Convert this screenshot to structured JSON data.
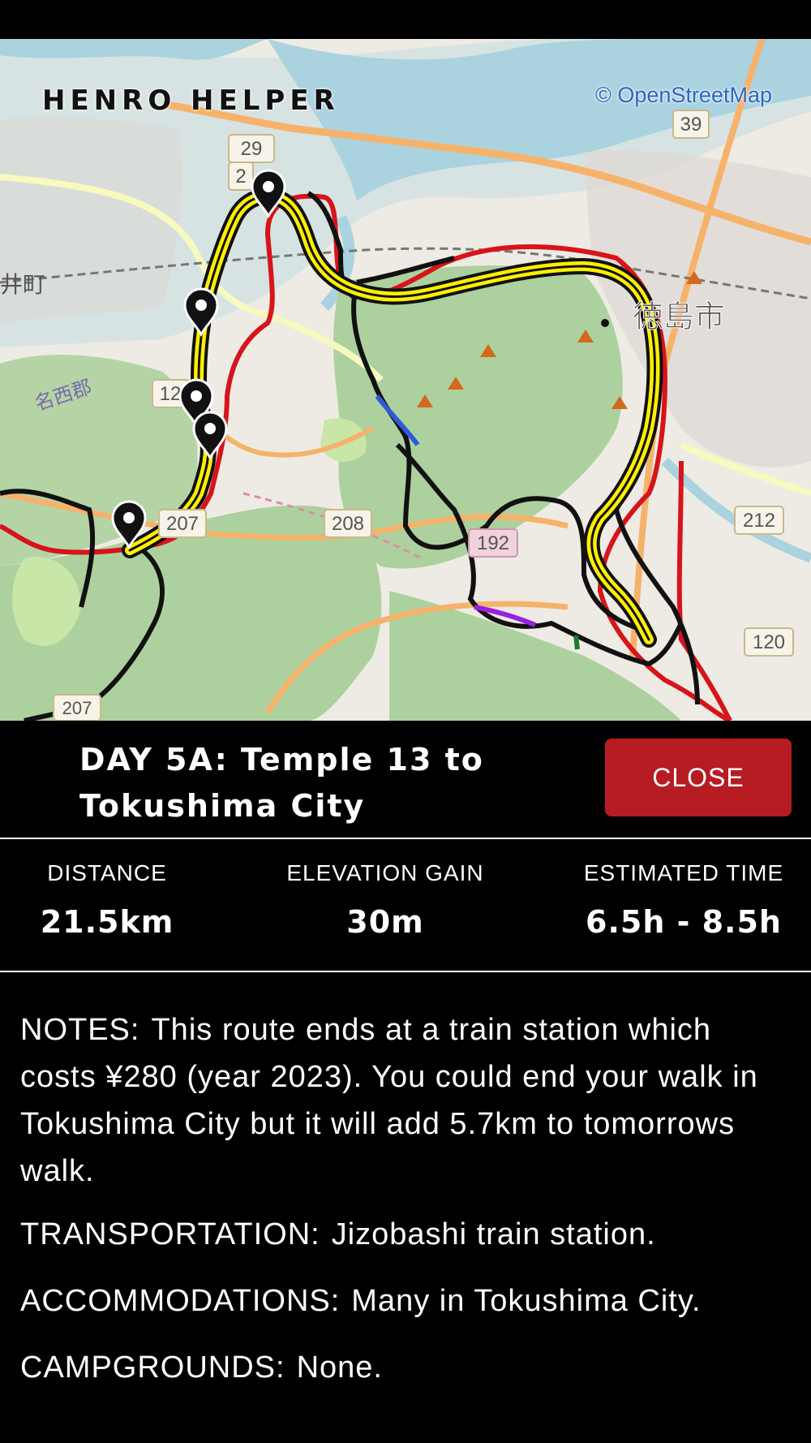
{
  "map": {
    "brand": "HENRO HELPER",
    "attribution": "© OpenStreetMap",
    "road_labels": [
      "29",
      "2",
      "39",
      "12",
      "207",
      "208",
      "192",
      "212",
      "120",
      "207"
    ],
    "place_labels": [
      "徳島市",
      "井町",
      "名西郡"
    ]
  },
  "header": {
    "title": "DAY 5A:  Temple 13 to\nTokushima City",
    "close_label": "CLOSE",
    "close_color": "#b71c22"
  },
  "stats": [
    {
      "label": "DISTANCE",
      "value": "21.5km"
    },
    {
      "label": "ELEVATION GAIN",
      "value": "30m"
    },
    {
      "label": "ESTIMATED TIME",
      "value": "6.5h - 8.5h"
    }
  ],
  "notes": {
    "main_label": "NOTES:",
    "main_text": "This route ends at a train station which costs ¥280 (year 2023). You could end your walk in Tokushima City but it will add 5.7km to tomorrows walk.",
    "transportation_label": "TRANSPORTATION:",
    "transportation_text": "Jizobashi train station.",
    "accommodations_label": "ACCOMMODATIONS:",
    "accommodations_text": "Many in Tokushima City.",
    "campgrounds_label": "CAMPGROUNDS:",
    "campgrounds_text": "None."
  },
  "colors": {
    "route_highlight": "#ffef00",
    "route_red": "#d7141a",
    "route_black": "#111111",
    "water": "#aad3df",
    "forest": "#add19e"
  }
}
